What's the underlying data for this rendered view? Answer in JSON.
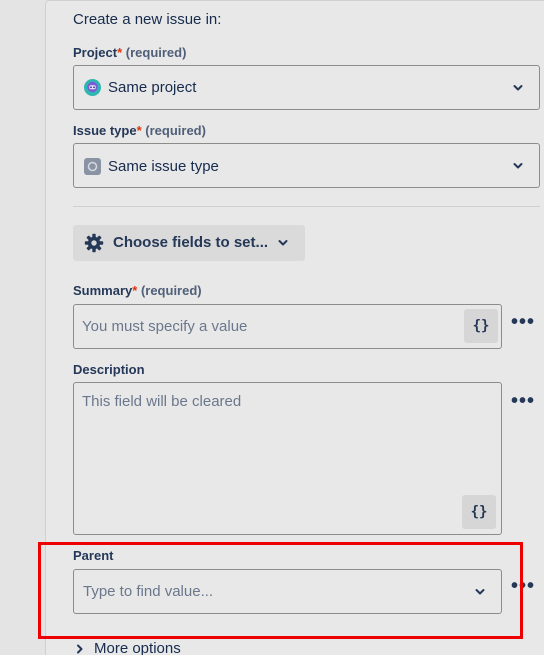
{
  "form": {
    "heading": "Create a new issue in:",
    "project": {
      "label": "Project",
      "required_mark": "*",
      "required_text": "(required)",
      "value": "Same project",
      "icon": "project-avatar-icon"
    },
    "issue_type": {
      "label": "Issue type",
      "required_mark": "*",
      "required_text": "(required)",
      "value": "Same issue type",
      "icon": "issue-type-icon"
    },
    "choose_fields": {
      "label": "Choose fields to set...",
      "icon": "gear-icon"
    },
    "summary": {
      "label": "Summary",
      "required_mark": "*",
      "required_text": "(required)",
      "placeholder": "You must specify a value",
      "brace": "{}",
      "more_icon": "more-icon"
    },
    "description": {
      "label": "Description",
      "placeholder": "This field will be cleared",
      "brace": "{}",
      "more_icon": "more-icon"
    },
    "parent": {
      "label": "Parent",
      "placeholder": "Type to find value...",
      "more_icon": "more-icon"
    },
    "more_options": "More options"
  },
  "colors": {
    "background": "#e8e8e8",
    "required_star": "#de350b",
    "highlight": "#ee0000"
  }
}
